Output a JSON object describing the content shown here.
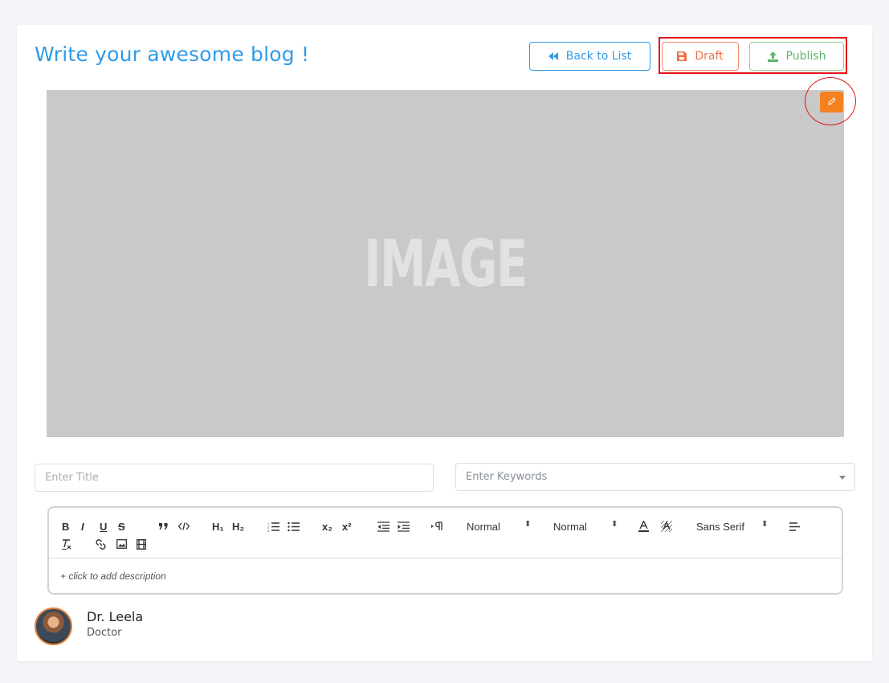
{
  "header": {
    "title": "Write your awesome blog !",
    "back_label": "Back to List",
    "draft_label": "Draft",
    "publish_label": "Publish"
  },
  "cover": {
    "placeholder_text": "IMAGE"
  },
  "form": {
    "title_placeholder": "Enter Title",
    "keywords_placeholder": "Enter Keywords"
  },
  "editor": {
    "toolbar": {
      "bold": "B",
      "italic": "I",
      "underline": "U",
      "strike": "S",
      "h1": "H₁",
      "h2": "H₂",
      "sub": "x₂",
      "sup": "x²",
      "size_value": "Normal",
      "header_value": "Normal",
      "font_value": "Sans Serif"
    },
    "description_placeholder": "+ click to add description"
  },
  "author": {
    "name": "Dr. Leela",
    "role": "Doctor"
  },
  "colors": {
    "accent_blue": "#2f9be8",
    "draft_orange": "#f0704a",
    "publish_green": "#5cb86a",
    "edit_orange": "#f58220",
    "annotation_red": "#e4151a"
  }
}
